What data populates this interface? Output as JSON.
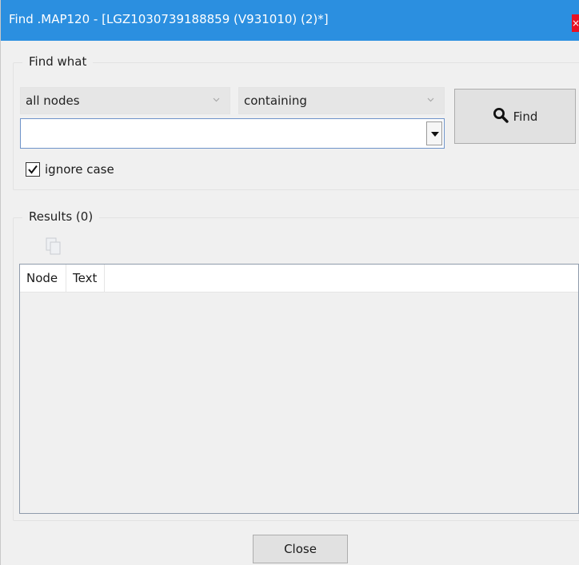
{
  "window": {
    "title": "Find .MAP120 - [LGZ1030739188859 (V931010) (2)*]",
    "close_glyph": "×"
  },
  "find_group": {
    "label": "Find what",
    "scope_combo": {
      "value": "all nodes",
      "icon": "chevron-down-icon"
    },
    "mode_combo": {
      "value": "containing",
      "icon": "chevron-down-icon"
    },
    "search_input": {
      "value": "",
      "placeholder": ""
    },
    "find_button": {
      "label": "Find",
      "icon": "search-icon"
    },
    "ignore_case": {
      "label": "ignore case",
      "checked": true
    }
  },
  "results_group": {
    "label": "Results (0)",
    "copy_icon": "copy-icon",
    "columns": [
      "Node",
      "Text"
    ],
    "rows": []
  },
  "footer": {
    "close_label": "Close"
  },
  "colors": {
    "titlebar": "#2b8fe0",
    "window_bg": "#f0f0f0",
    "input_border": "#6e93c9"
  }
}
